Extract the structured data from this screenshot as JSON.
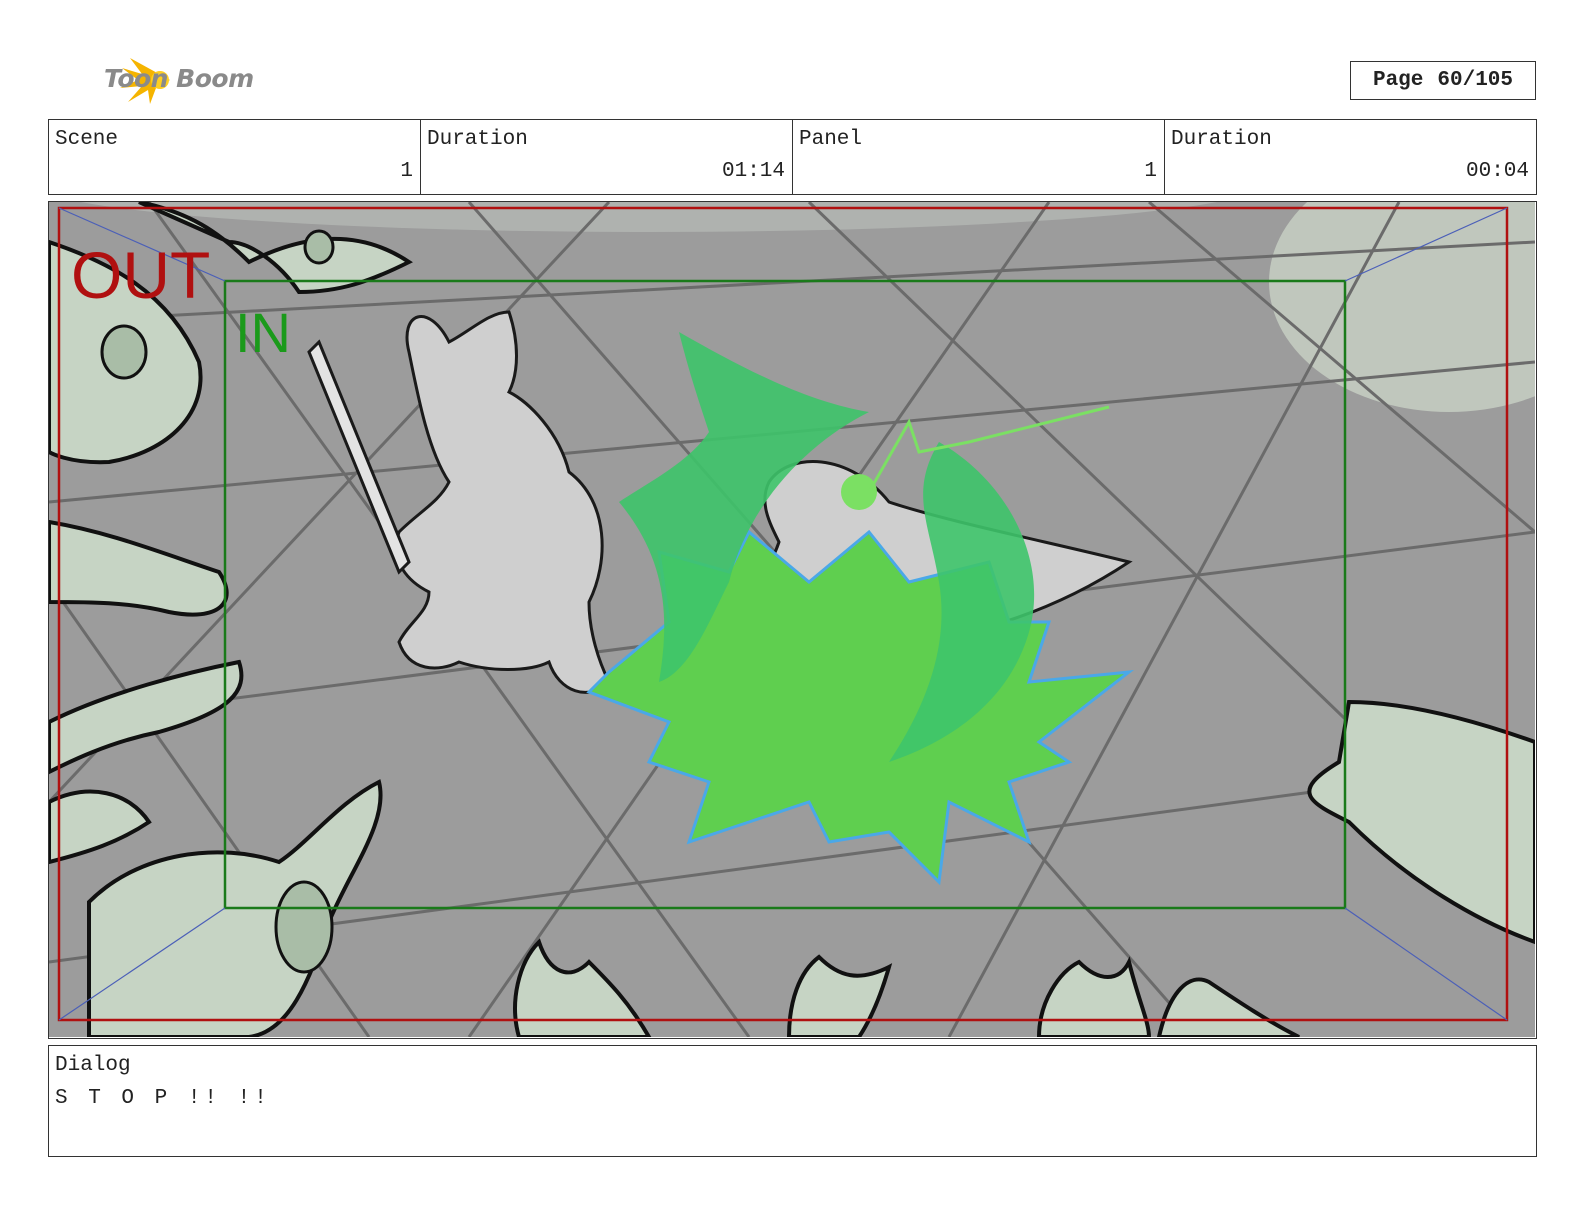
{
  "header": {
    "logo_text": "Toon Boom",
    "page_label": "Page",
    "page_value": "60/105"
  },
  "info": {
    "scene_label": "Scene",
    "scene_value": "1",
    "scene_duration_label": "Duration",
    "scene_duration_value": "01:14",
    "panel_label": "Panel",
    "panel_value": "1",
    "panel_duration_label": "Duration",
    "panel_duration_value": "00:04"
  },
  "panel": {
    "out_label": "OUT",
    "in_label": "IN",
    "colors": {
      "floor": "#9c9c9c",
      "out_frame": "#b01010",
      "in_frame": "#1a7a1a",
      "ghost": "#c6d4c4",
      "magic": "#5fcf4f",
      "magic_outline": "#4aa8e8"
    }
  },
  "dialog": {
    "label": "Dialog",
    "text": "S T O P !! !!"
  }
}
